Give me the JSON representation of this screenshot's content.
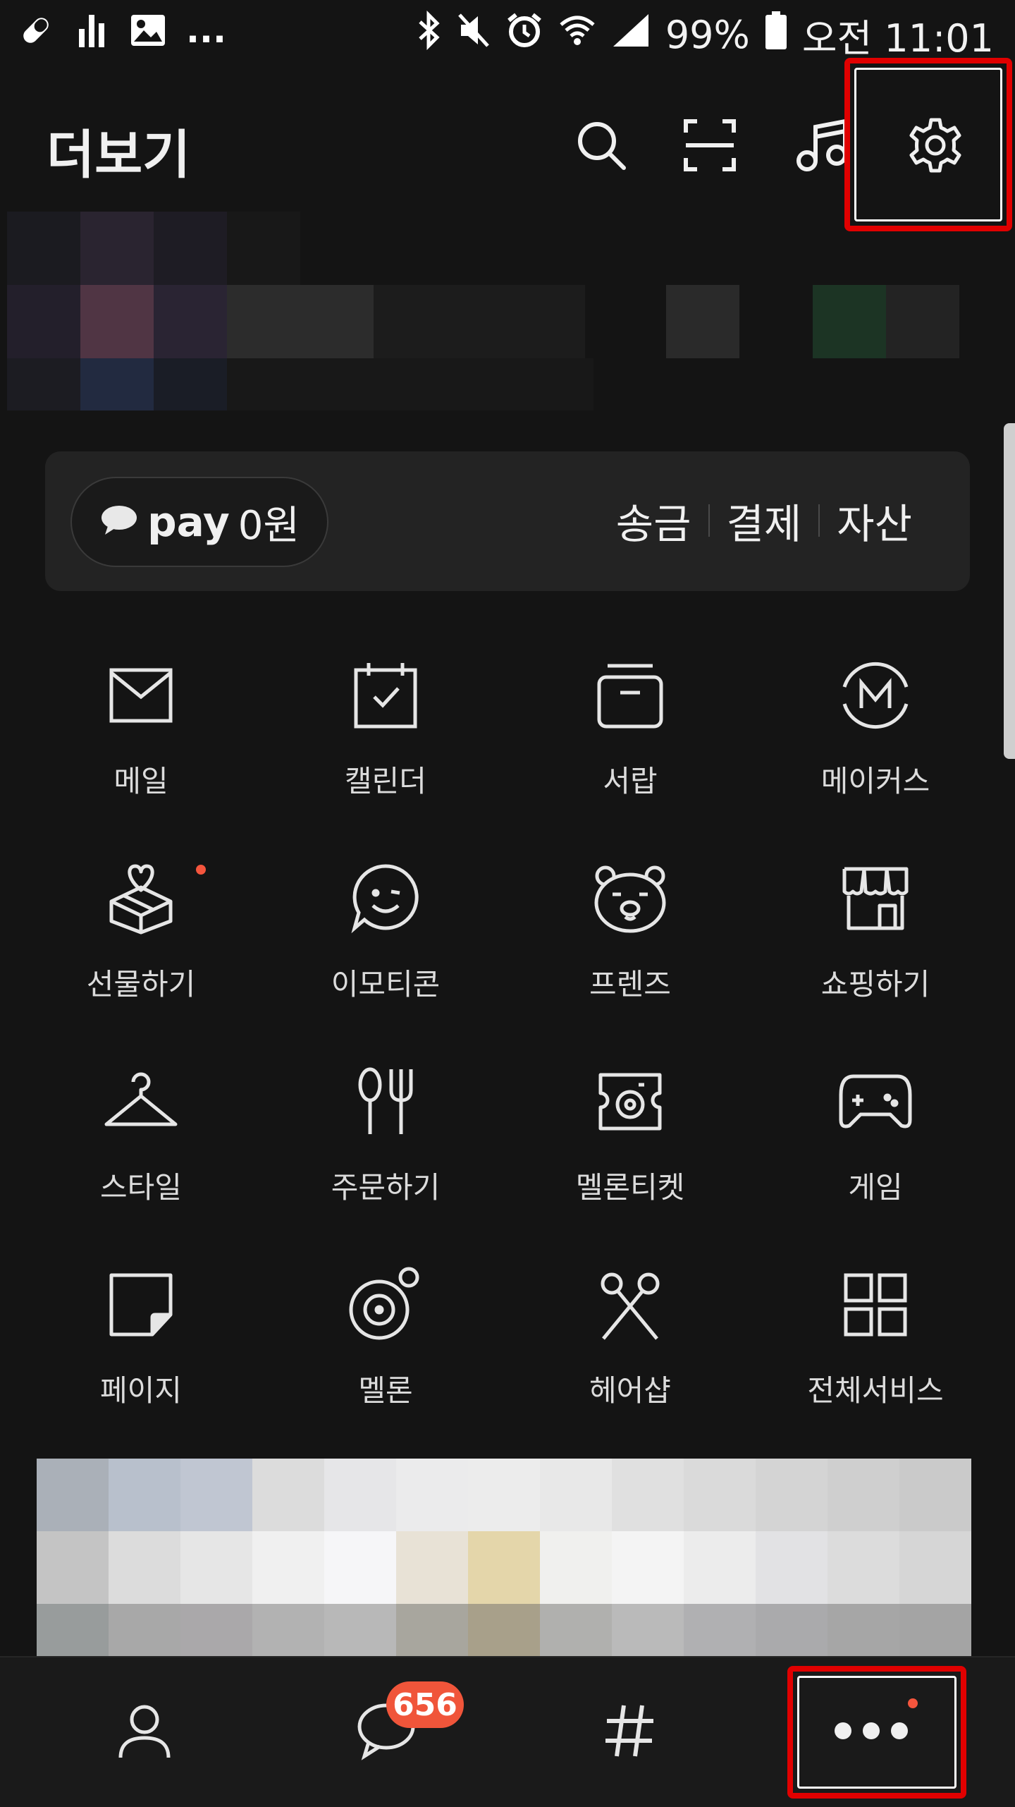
{
  "status_bar": {
    "battery": "99%",
    "time": "오전 11:01",
    "ellipsis": "...",
    "left_icons": [
      "pill-icon",
      "equalizer-icon",
      "image-icon"
    ],
    "right_icons": [
      "bluetooth-icon",
      "mute-icon",
      "alarm-icon",
      "wifi-icon",
      "signal-icon",
      "battery-icon"
    ]
  },
  "header": {
    "title": "더보기",
    "icons": [
      "search-icon",
      "scan-icon",
      "music-icon",
      "settings-icon"
    ]
  },
  "pay": {
    "brand": "pay",
    "amount": "0원",
    "links": [
      "송금",
      "결제",
      "자산"
    ]
  },
  "services": [
    {
      "label": "메일",
      "icon": "mail-icon"
    },
    {
      "label": "캘린더",
      "icon": "calendar-icon"
    },
    {
      "label": "서랍",
      "icon": "drawer-icon"
    },
    {
      "label": "메이커스",
      "icon": "makers-icon"
    },
    {
      "label": "선물하기",
      "icon": "gift-icon",
      "new_dot": true
    },
    {
      "label": "이모티콘",
      "icon": "emoticon-icon"
    },
    {
      "label": "프렌즈",
      "icon": "friends-icon"
    },
    {
      "label": "쇼핑하기",
      "icon": "shop-icon"
    },
    {
      "label": "스타일",
      "icon": "hanger-icon"
    },
    {
      "label": "주문하기",
      "icon": "utensils-icon"
    },
    {
      "label": "멜론티켓",
      "icon": "ticket-icon"
    },
    {
      "label": "게임",
      "icon": "gamepad-icon"
    },
    {
      "label": "페이지",
      "icon": "page-icon"
    },
    {
      "label": "멜론",
      "icon": "melon-icon"
    },
    {
      "label": "헤어샵",
      "icon": "scissors-icon"
    },
    {
      "label": "전체서비스",
      "icon": "grid-icon"
    }
  ],
  "bottom_nav": {
    "items": [
      "friends-tab-icon",
      "chats-tab-icon",
      "hashtag-tab-icon",
      "more-tab-icon"
    ],
    "chat_badge": "656"
  },
  "colors": {
    "background": "#141414",
    "badge": "#f0553a",
    "highlight": "#e10000"
  }
}
